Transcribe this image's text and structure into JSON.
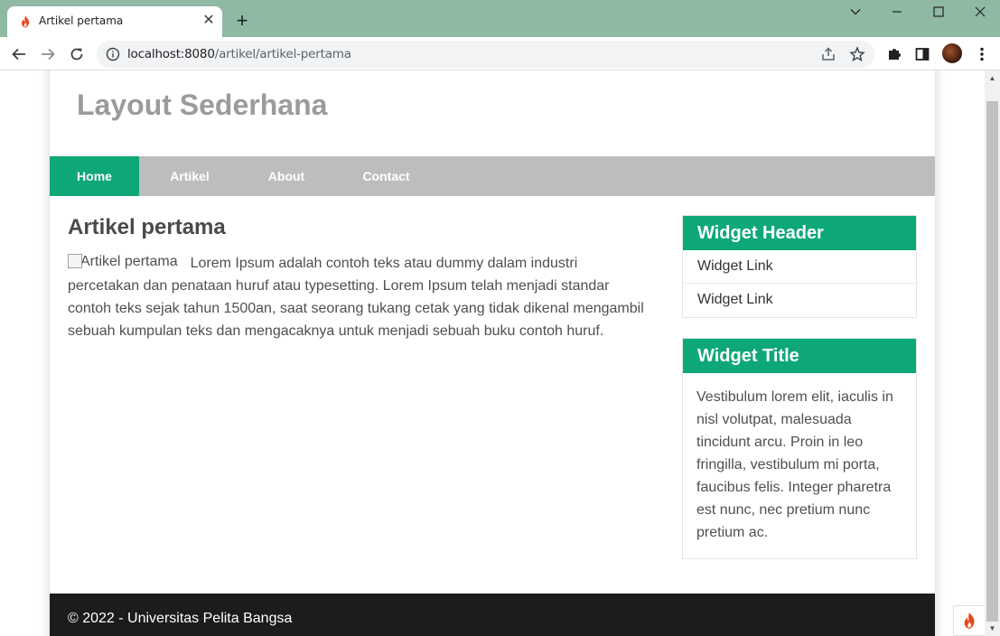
{
  "browser": {
    "tab_title": "Artikel pertama",
    "url_host": "localhost:8080",
    "url_path": "/artikel/artikel-pertama"
  },
  "site": {
    "title": "Layout Sederhana",
    "nav": [
      {
        "label": "Home",
        "active": true
      },
      {
        "label": "Artikel",
        "active": false
      },
      {
        "label": "About",
        "active": false
      },
      {
        "label": "Contact",
        "active": false
      }
    ]
  },
  "article": {
    "title": "Artikel pertama",
    "image_alt": "Artikel pertama",
    "body": "Lorem Ipsum adalah contoh teks atau dummy dalam industri percetakan dan penataan huruf atau typesetting. Lorem Ipsum telah menjadi standar contoh teks sejak tahun 1500an, saat seorang tukang cetak yang tidak dikenal mengambil sebuah kumpulan teks dan mengacaknya untuk menjadi sebuah buku contoh huruf."
  },
  "sidebar": {
    "widget1": {
      "header": "Widget Header",
      "links": [
        "Widget Link",
        "Widget Link"
      ]
    },
    "widget2": {
      "header": "Widget Title",
      "text": "Vestibulum lorem elit, iaculis in nisl volutpat, malesuada tincidunt arcu. Proin in leo fringilla, vestibulum mi porta, faucibus felis. Integer pharetra est nunc, nec pretium nunc pretium ac."
    }
  },
  "footer": {
    "text": "© 2022 - Universitas Pelita Bangsa"
  },
  "colors": {
    "accent": "#0ea878",
    "nav_bg": "#bdbdbd",
    "footer_bg": "#1c1c1c",
    "browser_frame": "#8fb9a3"
  }
}
